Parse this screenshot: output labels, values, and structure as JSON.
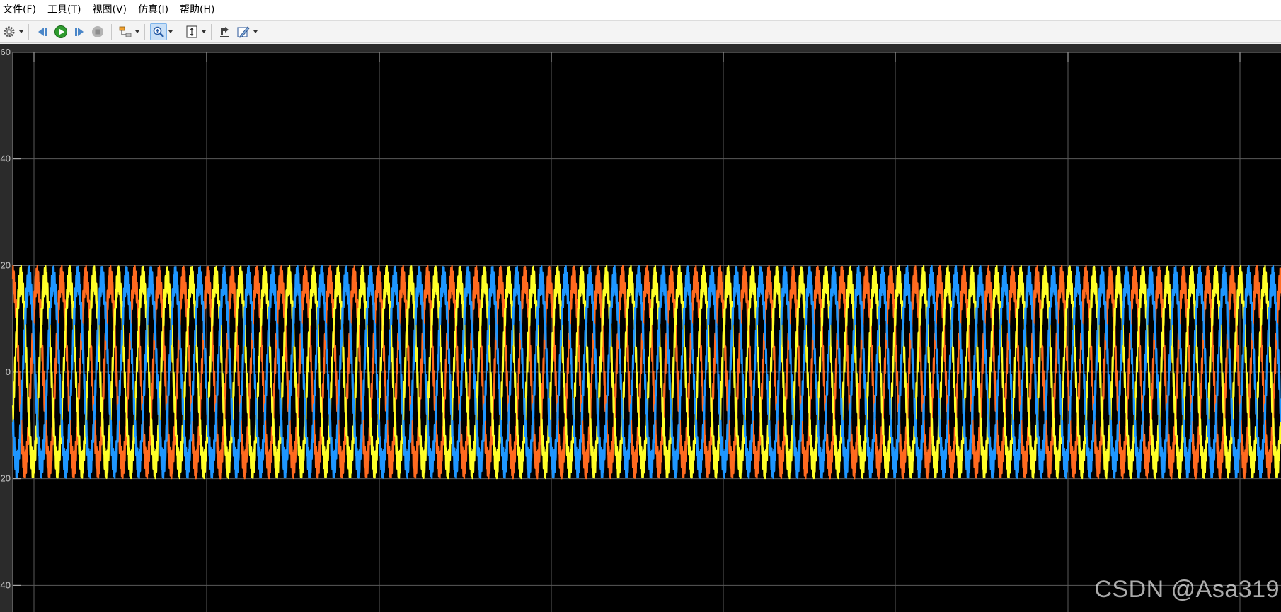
{
  "menu": {
    "file": "文件(F)",
    "tools": "工具(T)",
    "view": "视图(V)",
    "simulation": "仿真(I)",
    "help": "帮助(H)"
  },
  "toolbar": {
    "icons": [
      "settings-icon",
      "step-back-icon",
      "run-icon",
      "step-forward-icon",
      "stop-icon",
      "signal-selector-icon",
      "zoom-in-icon",
      "scale-axes-icon",
      "cursor-measure-icon",
      "style-icon"
    ],
    "active": "zoom-in-icon"
  },
  "watermark": "CSDN @Asa319",
  "colors": {
    "plot_background": "#000000",
    "grid": "#5a5a5a",
    "axis_text": "#c8c8c8",
    "phase_a": "#ff6a1f",
    "phase_b": "#ffff28",
    "phase_c": "#1e96ff"
  },
  "chart_data": {
    "type": "line",
    "title": "",
    "xlabel": "",
    "ylabel": "",
    "ylim": [
      -45,
      60
    ],
    "yticks": [
      60,
      40,
      20,
      0,
      -20,
      -40
    ],
    "ytick_labels": [
      "60",
      "40",
      "20",
      "0",
      "20",
      "40"
    ],
    "grid": true,
    "legend": "none",
    "x_cycles_visible": 52,
    "series": [
      {
        "color": "#ff6a1f",
        "amplitude": 17.5,
        "ripple_amplitude": 2.5,
        "phase_deg": 90
      },
      {
        "color": "#ffff28",
        "amplitude": 17.5,
        "ripple_amplitude": 2.5,
        "phase_deg": -30
      },
      {
        "color": "#1e96ff",
        "amplitude": 17.5,
        "ripple_amplitude": 2.5,
        "phase_deg": 210
      }
    ]
  }
}
